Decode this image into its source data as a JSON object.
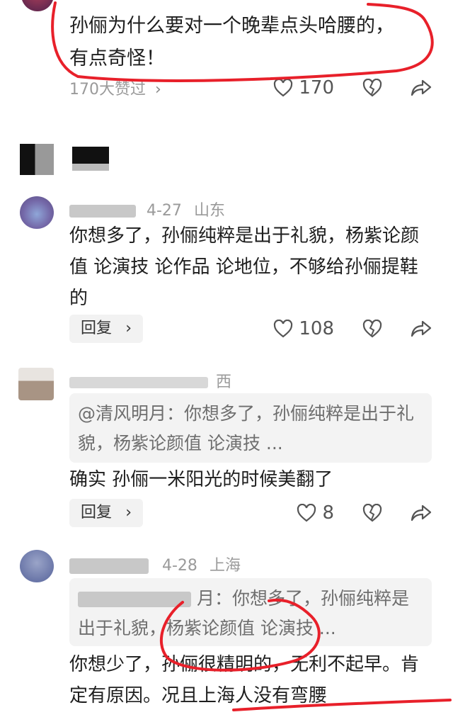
{
  "comments": [
    {
      "text": "孙俪为什么要对一个晚辈点头哈腰的，有点奇怪！",
      "likes_summary": "170大赞过",
      "likes": "170"
    },
    {
      "meta_date": "4-27",
      "meta_region": "山东",
      "text": "你想多了，孙俪纯粹是出于礼貌，杨紫论颜值 论演技 论作品 论地位，不够给孙俪提鞋的",
      "reply_label": "回复",
      "likes": "108"
    },
    {
      "meta_region": "西",
      "quote": "@清风明月：你想多了，孙俪纯粹是出于礼貌，杨紫论颜值 论演技 ...",
      "text": "确实 孙俪一米阳光的时候美翻了",
      "reply_label": "回复",
      "likes": "8"
    },
    {
      "meta_date": "4-28",
      "meta_region": "上海",
      "quote_tail": "月：你想多了，孙俪纯粹是出于礼貌，杨紫论颜值 论演技 ...",
      "text": "你想少了，孙俪很精明的，无利不起早。肯定有原因。况且上海人没有弯腰"
    }
  ],
  "icons": {
    "like": "heart-outline-icon",
    "dislike": "broken-heart-icon",
    "share": "share-arrow-icon",
    "chevron": "chevron-right-icon"
  },
  "colors": {
    "annotation_red": "#e8202a",
    "text": "#1e1e1e",
    "muted": "#9a9a9a",
    "quote_bg": "#f3f3f3"
  }
}
